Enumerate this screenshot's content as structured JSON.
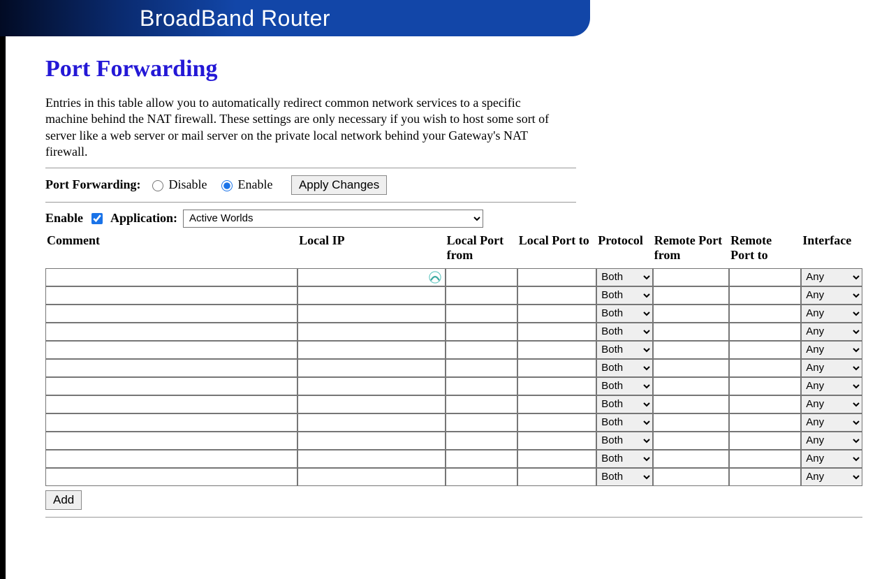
{
  "header": {
    "product_title": "BroadBand Router"
  },
  "page": {
    "title": "Port Forwarding",
    "description": "Entries in this table allow you to automatically redirect common network services to a specific machine behind the NAT firewall. These settings are only necessary if you wish to host some sort of server like a web server or mail server on the private local network behind your Gateway's NAT firewall."
  },
  "pf_toggle": {
    "label": "Port Forwarding:",
    "disable_label": "Disable",
    "enable_label": "Enable",
    "selected": "enable",
    "apply_label": "Apply Changes"
  },
  "enable_row": {
    "enable_label": "Enable",
    "checked": true,
    "application_label": "Application:",
    "application_selected": "Active Worlds"
  },
  "table": {
    "headers": {
      "comment": "Comment",
      "local_ip": "Local IP",
      "local_port_from": "Local Port from",
      "local_port_to": "Local Port to",
      "protocol": "Protocol",
      "remote_port_from": "Remote Port from",
      "remote_port_to": "Remote Port to",
      "interface": "Interface"
    },
    "protocol_default": "Both",
    "interface_default": "Any",
    "row_count": 12,
    "add_label": "Add"
  }
}
